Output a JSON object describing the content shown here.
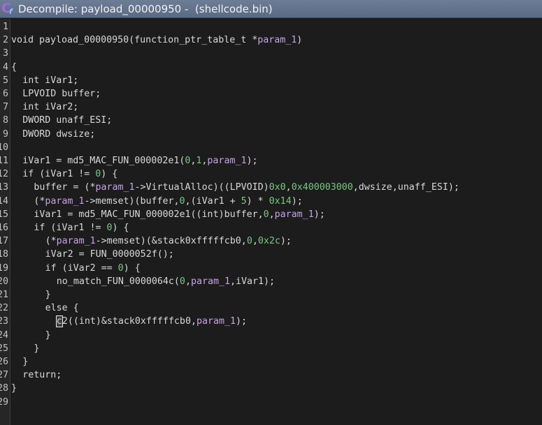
{
  "window": {
    "title": "Decompile: payload_00000950 -  (shellcode.bin)",
    "icon": "ghidra-decompiler-icon"
  },
  "lines": [
    {
      "num": "1",
      "indent": 0,
      "tokens": []
    },
    {
      "num": "2",
      "indent": 0,
      "tokens": [
        {
          "t": "void payload_00000950(function_ptr_table_t *",
          "c": "p"
        },
        {
          "t": "param_1",
          "c": "var"
        },
        {
          "t": ")",
          "c": "p"
        }
      ]
    },
    {
      "num": "3",
      "indent": 0,
      "tokens": []
    },
    {
      "num": "4",
      "indent": 0,
      "tokens": [
        {
          "t": "{",
          "c": "p"
        }
      ]
    },
    {
      "num": "5",
      "indent": 2,
      "tokens": [
        {
          "t": "int iVar1;",
          "c": "p"
        }
      ]
    },
    {
      "num": "6",
      "indent": 2,
      "tokens": [
        {
          "t": "LPVOID buffer;",
          "c": "p"
        }
      ]
    },
    {
      "num": "7",
      "indent": 2,
      "tokens": [
        {
          "t": "int iVar2;",
          "c": "p"
        }
      ]
    },
    {
      "num": "8",
      "indent": 2,
      "tokens": [
        {
          "t": "DWORD unaff_ESI;",
          "c": "p"
        }
      ]
    },
    {
      "num": "9",
      "indent": 2,
      "tokens": [
        {
          "t": "DWORD dwsize;",
          "c": "p"
        }
      ]
    },
    {
      "num": "10",
      "indent": 0,
      "tokens": []
    },
    {
      "num": "11",
      "indent": 2,
      "tokens": [
        {
          "t": "iVar1 = md5_MAC_FUN_000002e1(",
          "c": "p"
        },
        {
          "t": "0",
          "c": "num"
        },
        {
          "t": ",",
          "c": "p"
        },
        {
          "t": "1",
          "c": "num"
        },
        {
          "t": ",",
          "c": "p"
        },
        {
          "t": "param_1",
          "c": "var"
        },
        {
          "t": ");",
          "c": "p"
        }
      ]
    },
    {
      "num": "12",
      "indent": 2,
      "tokens": [
        {
          "t": "if (iVar1 != ",
          "c": "p"
        },
        {
          "t": "0",
          "c": "num"
        },
        {
          "t": ") {",
          "c": "p"
        }
      ]
    },
    {
      "num": "13",
      "indent": 4,
      "tokens": [
        {
          "t": "buffer = (*",
          "c": "p"
        },
        {
          "t": "param_1",
          "c": "var"
        },
        {
          "t": "->VirtualAlloc)((LPVOID)",
          "c": "p"
        },
        {
          "t": "0x0",
          "c": "num"
        },
        {
          "t": ",",
          "c": "p"
        },
        {
          "t": "0x400003000",
          "c": "num"
        },
        {
          "t": ",dwsize,unaff_ESI);",
          "c": "p"
        }
      ]
    },
    {
      "num": "14",
      "indent": 4,
      "tokens": [
        {
          "t": "(*",
          "c": "p"
        },
        {
          "t": "param_1",
          "c": "var"
        },
        {
          "t": "->memset)(buffer,",
          "c": "p"
        },
        {
          "t": "0",
          "c": "num"
        },
        {
          "t": ",(iVar1 + ",
          "c": "p"
        },
        {
          "t": "5",
          "c": "num"
        },
        {
          "t": ") * ",
          "c": "p"
        },
        {
          "t": "0x14",
          "c": "num"
        },
        {
          "t": ");",
          "c": "p"
        }
      ]
    },
    {
      "num": "15",
      "indent": 4,
      "tokens": [
        {
          "t": "iVar1 = md5_MAC_FUN_000002e1((int)buffer,",
          "c": "p"
        },
        {
          "t": "0",
          "c": "num"
        },
        {
          "t": ",",
          "c": "p"
        },
        {
          "t": "param_1",
          "c": "var"
        },
        {
          "t": ");",
          "c": "p"
        }
      ]
    },
    {
      "num": "16",
      "indent": 4,
      "tokens": [
        {
          "t": "if (iVar1 != ",
          "c": "p"
        },
        {
          "t": "0",
          "c": "num"
        },
        {
          "t": ") {",
          "c": "p"
        }
      ]
    },
    {
      "num": "17",
      "indent": 6,
      "tokens": [
        {
          "t": "(*",
          "c": "p"
        },
        {
          "t": "param_1",
          "c": "var"
        },
        {
          "t": "->memset)(&stack0xfffffcb0,",
          "c": "p"
        },
        {
          "t": "0",
          "c": "num"
        },
        {
          "t": ",",
          "c": "p"
        },
        {
          "t": "0x2c",
          "c": "num"
        },
        {
          "t": ");",
          "c": "p"
        }
      ]
    },
    {
      "num": "18",
      "indent": 6,
      "tokens": [
        {
          "t": "iVar2 = FUN_0000052f();",
          "c": "p"
        }
      ]
    },
    {
      "num": "19",
      "indent": 6,
      "tokens": [
        {
          "t": "if (iVar2 == ",
          "c": "p"
        },
        {
          "t": "0",
          "c": "num"
        },
        {
          "t": ") {",
          "c": "p"
        }
      ]
    },
    {
      "num": "20",
      "indent": 8,
      "tokens": [
        {
          "t": "no_match_FUN_0000064c(",
          "c": "p"
        },
        {
          "t": "0",
          "c": "num"
        },
        {
          "t": ",",
          "c": "p"
        },
        {
          "t": "param_1",
          "c": "var"
        },
        {
          "t": ",iVar1);",
          "c": "p"
        }
      ]
    },
    {
      "num": "21",
      "indent": 6,
      "tokens": [
        {
          "t": "}",
          "c": "p"
        }
      ]
    },
    {
      "num": "22",
      "indent": 6,
      "tokens": [
        {
          "t": "else {",
          "c": "p"
        }
      ]
    },
    {
      "num": "23",
      "indent": 8,
      "tokens": [
        {
          "t": "c",
          "c": "hl"
        },
        {
          "t": "2",
          "c": "p"
        },
        {
          "t": "((int)&stack0xfffffcb0,",
          "c": "p"
        },
        {
          "t": "param_1",
          "c": "var"
        },
        {
          "t": ");",
          "c": "p"
        }
      ]
    },
    {
      "num": "24",
      "indent": 6,
      "tokens": [
        {
          "t": "}",
          "c": "p"
        }
      ]
    },
    {
      "num": "25",
      "indent": 4,
      "tokens": [
        {
          "t": "}",
          "c": "p"
        }
      ]
    },
    {
      "num": "26",
      "indent": 2,
      "tokens": [
        {
          "t": "}",
          "c": "p"
        }
      ]
    },
    {
      "num": "27",
      "indent": 2,
      "tokens": [
        {
          "t": "return;",
          "c": "p"
        }
      ]
    },
    {
      "num": "28",
      "indent": 0,
      "tokens": [
        {
          "t": "}",
          "c": "p"
        }
      ]
    },
    {
      "num": "29",
      "indent": 0,
      "tokens": []
    }
  ],
  "colors": {
    "background": "#1c1c1c",
    "titlebar": "#62728c",
    "text": "#d8d8d8",
    "variable": "#c7a2e8",
    "number": "#79c783"
  }
}
